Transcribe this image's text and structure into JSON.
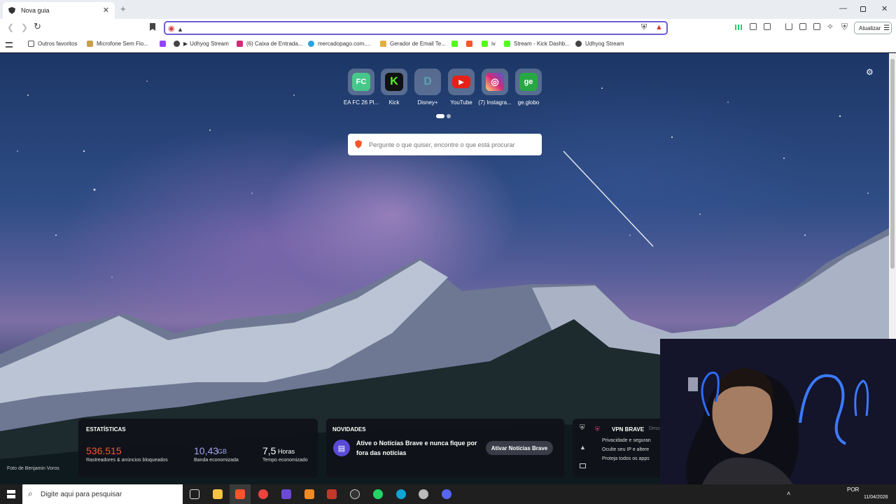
{
  "tab": {
    "title": "Nova guia"
  },
  "toolbar": {
    "update_label": "Atualizar"
  },
  "bookmarks": [
    {
      "label": "Outros favoritos"
    },
    {
      "label": "Microfone Sem Fio..."
    },
    {
      "label": "Udhyog Stream"
    },
    {
      "label": "(6) Caixa de Entrada..."
    },
    {
      "label": "mercadopago.com...."
    },
    {
      "label": "Gerador de Email Te..."
    },
    {
      "label": "iv"
    },
    {
      "label": "Stream - Kick Dashb..."
    },
    {
      "label": "Udhyog Stream"
    }
  ],
  "tiles": [
    {
      "label": "EA FC 26 Pl...",
      "glyph": "FC",
      "color": "#47c78a"
    },
    {
      "label": "Kick",
      "glyph": "K",
      "color": "#111111"
    },
    {
      "label": "Disney+",
      "glyph": "D",
      "color": "#5d9fb0"
    },
    {
      "label": "YouTube",
      "glyph": "▶",
      "color": "#e62117"
    },
    {
      "label": "(7) Instagra...",
      "glyph": "◎",
      "color": "#d62976"
    },
    {
      "label": "ge.globo",
      "glyph": "ge",
      "color": "#28a745"
    }
  ],
  "search": {
    "placeholder": "Pergunte o que quiser, encontre o que está procurar"
  },
  "stats": {
    "heading": "ESTATÍSTICAS",
    "trackers_value": "536.515",
    "trackers_label": "Rastreadores & anúncios bloqueados",
    "bandwidth_value": "10,43",
    "bandwidth_unit": "GB",
    "bandwidth_label": "Banda economizada",
    "time_value": "7,5",
    "time_unit": "Horas",
    "time_label": "Tempo economizado"
  },
  "news": {
    "heading": "NOVIDADES",
    "text": "Ative o Notícias Brave e nunca fique por fora das notícias",
    "button": "Ativar Notícias Brave"
  },
  "vpn": {
    "title": "VPN BRAVE",
    "status": "Desc",
    "items": [
      "Privacidade e seguran",
      "Oculte seu IP e altere",
      "Proteja todos os apps"
    ]
  },
  "photo_credit": "Foto de Benjamin Voros",
  "taskbar": {
    "search_placeholder": "Digite aqui para pesquisar",
    "lang": "POR",
    "date": "11/04/2026"
  },
  "colors": {
    "accent": "#6c5ed6",
    "trackers": "#fb542b",
    "bandwidth": "#a0a5eb"
  }
}
